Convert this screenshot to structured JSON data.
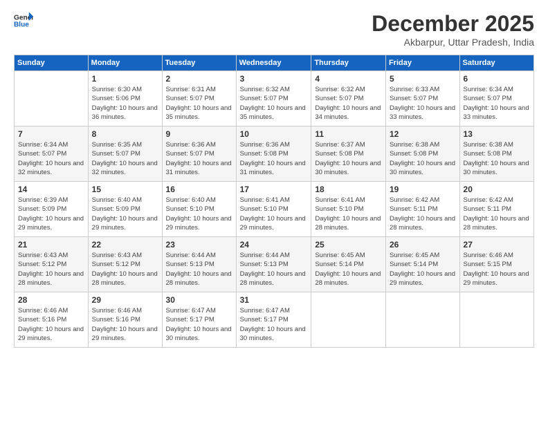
{
  "logo": {
    "line1": "General",
    "line2": "Blue"
  },
  "title": "December 2025",
  "location": "Akbarpur, Uttar Pradesh, India",
  "weekdays": [
    "Sunday",
    "Monday",
    "Tuesday",
    "Wednesday",
    "Thursday",
    "Friday",
    "Saturday"
  ],
  "weeks": [
    [
      {
        "day": "",
        "sunrise": "",
        "sunset": "",
        "daylight": ""
      },
      {
        "day": "1",
        "sunrise": "Sunrise: 6:30 AM",
        "sunset": "Sunset: 5:06 PM",
        "daylight": "Daylight: 10 hours and 36 minutes."
      },
      {
        "day": "2",
        "sunrise": "Sunrise: 6:31 AM",
        "sunset": "Sunset: 5:07 PM",
        "daylight": "Daylight: 10 hours and 35 minutes."
      },
      {
        "day": "3",
        "sunrise": "Sunrise: 6:32 AM",
        "sunset": "Sunset: 5:07 PM",
        "daylight": "Daylight: 10 hours and 35 minutes."
      },
      {
        "day": "4",
        "sunrise": "Sunrise: 6:32 AM",
        "sunset": "Sunset: 5:07 PM",
        "daylight": "Daylight: 10 hours and 34 minutes."
      },
      {
        "day": "5",
        "sunrise": "Sunrise: 6:33 AM",
        "sunset": "Sunset: 5:07 PM",
        "daylight": "Daylight: 10 hours and 33 minutes."
      },
      {
        "day": "6",
        "sunrise": "Sunrise: 6:34 AM",
        "sunset": "Sunset: 5:07 PM",
        "daylight": "Daylight: 10 hours and 33 minutes."
      }
    ],
    [
      {
        "day": "7",
        "sunrise": "Sunrise: 6:34 AM",
        "sunset": "Sunset: 5:07 PM",
        "daylight": "Daylight: 10 hours and 32 minutes."
      },
      {
        "day": "8",
        "sunrise": "Sunrise: 6:35 AM",
        "sunset": "Sunset: 5:07 PM",
        "daylight": "Daylight: 10 hours and 32 minutes."
      },
      {
        "day": "9",
        "sunrise": "Sunrise: 6:36 AM",
        "sunset": "Sunset: 5:07 PM",
        "daylight": "Daylight: 10 hours and 31 minutes."
      },
      {
        "day": "10",
        "sunrise": "Sunrise: 6:36 AM",
        "sunset": "Sunset: 5:08 PM",
        "daylight": "Daylight: 10 hours and 31 minutes."
      },
      {
        "day": "11",
        "sunrise": "Sunrise: 6:37 AM",
        "sunset": "Sunset: 5:08 PM",
        "daylight": "Daylight: 10 hours and 30 minutes."
      },
      {
        "day": "12",
        "sunrise": "Sunrise: 6:38 AM",
        "sunset": "Sunset: 5:08 PM",
        "daylight": "Daylight: 10 hours and 30 minutes."
      },
      {
        "day": "13",
        "sunrise": "Sunrise: 6:38 AM",
        "sunset": "Sunset: 5:08 PM",
        "daylight": "Daylight: 10 hours and 30 minutes."
      }
    ],
    [
      {
        "day": "14",
        "sunrise": "Sunrise: 6:39 AM",
        "sunset": "Sunset: 5:09 PM",
        "daylight": "Daylight: 10 hours and 29 minutes."
      },
      {
        "day": "15",
        "sunrise": "Sunrise: 6:40 AM",
        "sunset": "Sunset: 5:09 PM",
        "daylight": "Daylight: 10 hours and 29 minutes."
      },
      {
        "day": "16",
        "sunrise": "Sunrise: 6:40 AM",
        "sunset": "Sunset: 5:10 PM",
        "daylight": "Daylight: 10 hours and 29 minutes."
      },
      {
        "day": "17",
        "sunrise": "Sunrise: 6:41 AM",
        "sunset": "Sunset: 5:10 PM",
        "daylight": "Daylight: 10 hours and 29 minutes."
      },
      {
        "day": "18",
        "sunrise": "Sunrise: 6:41 AM",
        "sunset": "Sunset: 5:10 PM",
        "daylight": "Daylight: 10 hours and 28 minutes."
      },
      {
        "day": "19",
        "sunrise": "Sunrise: 6:42 AM",
        "sunset": "Sunset: 5:11 PM",
        "daylight": "Daylight: 10 hours and 28 minutes."
      },
      {
        "day": "20",
        "sunrise": "Sunrise: 6:42 AM",
        "sunset": "Sunset: 5:11 PM",
        "daylight": "Daylight: 10 hours and 28 minutes."
      }
    ],
    [
      {
        "day": "21",
        "sunrise": "Sunrise: 6:43 AM",
        "sunset": "Sunset: 5:12 PM",
        "daylight": "Daylight: 10 hours and 28 minutes."
      },
      {
        "day": "22",
        "sunrise": "Sunrise: 6:43 AM",
        "sunset": "Sunset: 5:12 PM",
        "daylight": "Daylight: 10 hours and 28 minutes."
      },
      {
        "day": "23",
        "sunrise": "Sunrise: 6:44 AM",
        "sunset": "Sunset: 5:13 PM",
        "daylight": "Daylight: 10 hours and 28 minutes."
      },
      {
        "day": "24",
        "sunrise": "Sunrise: 6:44 AM",
        "sunset": "Sunset: 5:13 PM",
        "daylight": "Daylight: 10 hours and 28 minutes."
      },
      {
        "day": "25",
        "sunrise": "Sunrise: 6:45 AM",
        "sunset": "Sunset: 5:14 PM",
        "daylight": "Daylight: 10 hours and 28 minutes."
      },
      {
        "day": "26",
        "sunrise": "Sunrise: 6:45 AM",
        "sunset": "Sunset: 5:14 PM",
        "daylight": "Daylight: 10 hours and 29 minutes."
      },
      {
        "day": "27",
        "sunrise": "Sunrise: 6:46 AM",
        "sunset": "Sunset: 5:15 PM",
        "daylight": "Daylight: 10 hours and 29 minutes."
      }
    ],
    [
      {
        "day": "28",
        "sunrise": "Sunrise: 6:46 AM",
        "sunset": "Sunset: 5:16 PM",
        "daylight": "Daylight: 10 hours and 29 minutes."
      },
      {
        "day": "29",
        "sunrise": "Sunrise: 6:46 AM",
        "sunset": "Sunset: 5:16 PM",
        "daylight": "Daylight: 10 hours and 29 minutes."
      },
      {
        "day": "30",
        "sunrise": "Sunrise: 6:47 AM",
        "sunset": "Sunset: 5:17 PM",
        "daylight": "Daylight: 10 hours and 30 minutes."
      },
      {
        "day": "31",
        "sunrise": "Sunrise: 6:47 AM",
        "sunset": "Sunset: 5:17 PM",
        "daylight": "Daylight: 10 hours and 30 minutes."
      },
      {
        "day": "",
        "sunrise": "",
        "sunset": "",
        "daylight": ""
      },
      {
        "day": "",
        "sunrise": "",
        "sunset": "",
        "daylight": ""
      },
      {
        "day": "",
        "sunrise": "",
        "sunset": "",
        "daylight": ""
      }
    ]
  ]
}
